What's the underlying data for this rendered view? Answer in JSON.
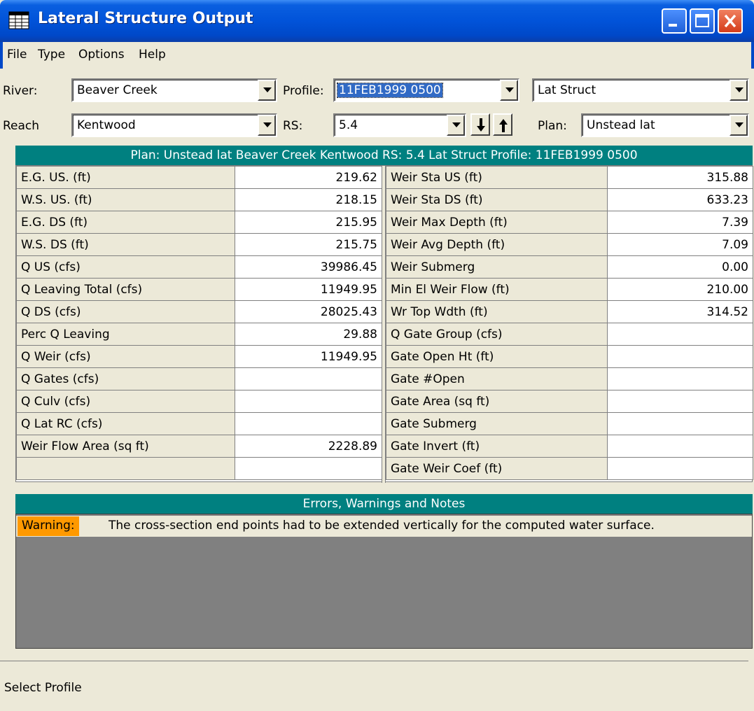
{
  "window": {
    "title": "Lateral Structure Output"
  },
  "menu": [
    "File",
    "Type",
    "Options",
    "Help"
  ],
  "controls": {
    "river_label": "River:",
    "river_value": "Beaver Creek",
    "reach_label": "Reach",
    "reach_value": "Kentwood",
    "profile_label": "Profile:",
    "profile_value": "11FEB1999 0500",
    "rs_label": "RS:",
    "rs_value": "5.4",
    "struct_value": "Lat Struct",
    "plan_label": "Plan:",
    "plan_value": "Unstead lat"
  },
  "summary_header": "Plan: Unstead lat    Beaver Creek    Kentwood  RS: 5.4   Lat Struct   Profile: 11FEB1999 0500",
  "left_table": [
    {
      "label": "E.G. US. (ft)",
      "value": "219.62"
    },
    {
      "label": "W.S. US. (ft)",
      "value": "218.15"
    },
    {
      "label": "E.G. DS (ft)",
      "value": "215.95"
    },
    {
      "label": "W.S. DS (ft)",
      "value": "215.75"
    },
    {
      "label": "Q US (cfs)",
      "value": "39986.45"
    },
    {
      "label": "Q Leaving Total (cfs)",
      "value": "11949.95"
    },
    {
      "label": "Q DS (cfs)",
      "value": "28025.43"
    },
    {
      "label": "Perc Q Leaving",
      "value": "29.88"
    },
    {
      "label": "Q Weir (cfs)",
      "value": "11949.95"
    },
    {
      "label": "Q Gates (cfs)",
      "value": ""
    },
    {
      "label": "Q Culv (cfs)",
      "value": ""
    },
    {
      "label": "Q Lat RC (cfs)",
      "value": ""
    },
    {
      "label": "Weir Flow Area (sq ft)",
      "value": "2228.89"
    },
    {
      "label": "",
      "value": ""
    }
  ],
  "right_table": [
    {
      "label": "Weir Sta US (ft)",
      "value": "315.88"
    },
    {
      "label": "Weir Sta DS (ft)",
      "value": "633.23"
    },
    {
      "label": "Weir Max Depth (ft)",
      "value": "7.39"
    },
    {
      "label": "Weir Avg Depth (ft)",
      "value": "7.09"
    },
    {
      "label": "Weir Submerg",
      "value": "0.00"
    },
    {
      "label": "Min El Weir Flow (ft)",
      "value": "210.00"
    },
    {
      "label": "Wr Top Wdth (ft)",
      "value": "314.52"
    },
    {
      "label": "Q Gate Group (cfs)",
      "value": ""
    },
    {
      "label": "Gate Open Ht (ft)",
      "value": ""
    },
    {
      "label": "Gate #Open",
      "value": ""
    },
    {
      "label": "Gate Area (sq ft)",
      "value": ""
    },
    {
      "label": "Gate Submerg",
      "value": ""
    },
    {
      "label": "Gate Invert (ft)",
      "value": ""
    },
    {
      "label": "Gate Weir Coef (ft)",
      "value": ""
    }
  ],
  "errors": {
    "header": "Errors, Warnings and Notes",
    "tag": "Warning:",
    "message": "The cross-section end points had to be extended vertically for the computed water surface."
  },
  "status_bar": "Select Profile",
  "colors": {
    "title_blue": "#0153d9",
    "teal": "#008080",
    "warning_orange": "#ff9900",
    "face": "#ece9d8"
  }
}
